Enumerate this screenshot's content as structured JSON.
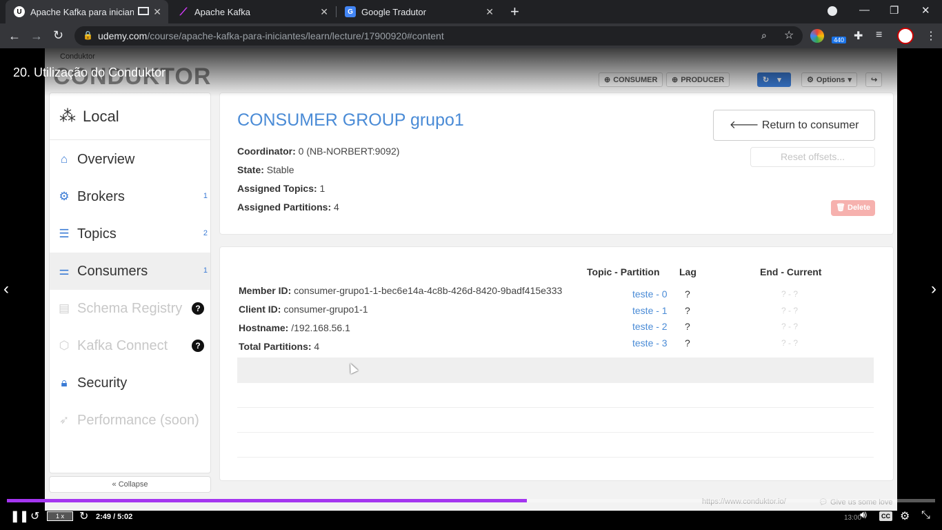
{
  "browser": {
    "tabs": [
      {
        "title": "Apache Kafka para iniciantes",
        "active": true
      },
      {
        "title": "Apache Kafka",
        "active": false
      },
      {
        "title": "Google Tradutor",
        "active": false
      }
    ],
    "new_tab": "+",
    "url_host": "udemy.com",
    "url_path": "/course/apache-kafka-para-iniciantes/learn/lecture/17900920#content",
    "extension_badge": "440"
  },
  "lecture_title": "20. Utilização do Conduktor",
  "app": {
    "window_title": "Conduktor",
    "logo": "CONDUKTOR",
    "top_buttons": {
      "consumer": "CONSUMER",
      "producer": "PRODUCER",
      "options": "Options"
    },
    "sidebar": {
      "cluster": "Local",
      "items": [
        {
          "label": "Overview",
          "count": "",
          "icon": "home-icon"
        },
        {
          "label": "Brokers",
          "count": "1",
          "icon": "cogs-icon"
        },
        {
          "label": "Topics",
          "count": "2",
          "icon": "server-icon"
        },
        {
          "label": "Consumers",
          "count": "1",
          "icon": "sliders-icon"
        },
        {
          "label": "Schema Registry",
          "count": "",
          "icon": "file-icon"
        },
        {
          "label": "Kafka Connect",
          "count": "",
          "icon": "connect-icon"
        },
        {
          "label": "Security",
          "count": "",
          "icon": "lock-icon"
        },
        {
          "label": "Performance (soon)",
          "count": "",
          "icon": "rocket-icon"
        }
      ],
      "collapse": "Collapse"
    },
    "group": {
      "title": "CONSUMER GROUP grupo1",
      "coordinator_label": "Coordinator:",
      "coordinator": "0 (NB-NORBERT:9092)",
      "state_label": "State:",
      "state": "Stable",
      "topics_label": "Assigned Topics:",
      "topics": "1",
      "partitions_label": "Assigned Partitions:",
      "partitions": "4",
      "return_button": "Return to consumer groups",
      "reset_button": "Reset offsets...",
      "delete_button": "Delete"
    },
    "member": {
      "headers": {
        "topic_partition": "Topic - Partition",
        "lag": "Lag",
        "end_current": "End - Current"
      },
      "member_id_label": "Member ID:",
      "member_id": "consumer-grupo1-1-bec6e14a-4c8b-426d-8420-9badf415e333",
      "client_id_label": "Client ID:",
      "client_id": "consumer-grupo1-1",
      "hostname_label": "Hostname:",
      "hostname": "/192.168.56.1",
      "total_label": "Total Partitions:",
      "total": "4",
      "partitions": [
        {
          "topic": "teste - 0",
          "lag": "?",
          "end_current": "? - ?"
        },
        {
          "topic": "teste - 1",
          "lag": "?",
          "end_current": "? - ?"
        },
        {
          "topic": "teste - 2",
          "lag": "?",
          "end_current": "? - ?"
        },
        {
          "topic": "teste - 3",
          "lag": "?",
          "end_current": "? - ?"
        }
      ]
    },
    "footer": {
      "link": "https://www.conduktor.io/",
      "love": "Give us some love"
    }
  },
  "player": {
    "time": "2:49 / 5:02",
    "rate": "1 x",
    "progress": 0.56,
    "clock": "13:00"
  },
  "colors": {
    "accent": "#4a8bd6",
    "udemy_purple": "#a435f0",
    "delete": "#f6b1ae"
  }
}
